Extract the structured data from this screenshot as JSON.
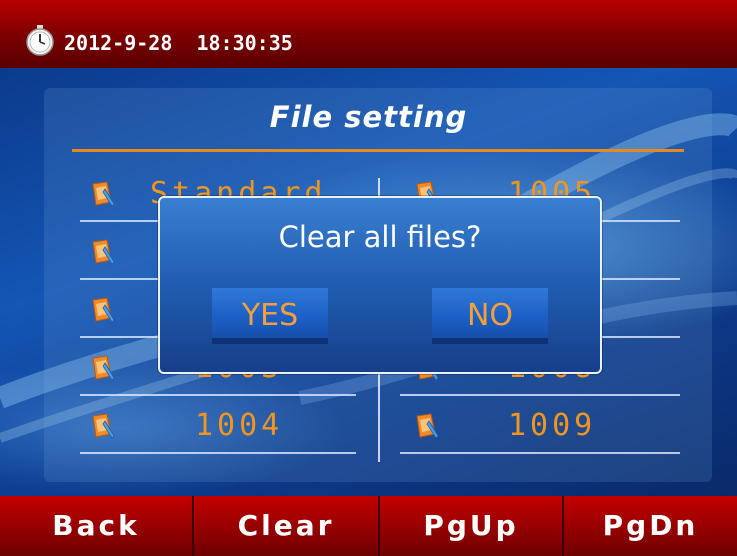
{
  "status_bar": {
    "datetime": "2012-9-28  18:30:35",
    "clock_icon": "stopwatch-icon"
  },
  "screen": {
    "title": "File setting"
  },
  "files": {
    "left": [
      {
        "label": "Standard",
        "icon": "file-edit-icon"
      },
      {
        "label": "",
        "icon": "file-edit-icon"
      },
      {
        "label": "",
        "icon": "file-edit-icon"
      },
      {
        "label": "1003",
        "icon": "file-edit-icon"
      },
      {
        "label": "1004",
        "icon": "file-edit-icon"
      }
    ],
    "right": [
      {
        "label": "1005",
        "icon": "file-edit-icon"
      },
      {
        "label": "",
        "icon": "file-edit-icon"
      },
      {
        "label": "",
        "icon": "file-edit-icon"
      },
      {
        "label": "1008",
        "icon": "file-edit-icon"
      },
      {
        "label": "1009",
        "icon": "file-edit-icon"
      }
    ]
  },
  "dialog": {
    "message": "Clear all files?",
    "yes_label": "YES",
    "no_label": "NO"
  },
  "bottom_bar": {
    "back_label": "Back",
    "clear_label": "Clear",
    "pgup_label": "PgUp",
    "pgdn_label": "PgDn"
  },
  "colors": {
    "accent_orange": "#f0951f",
    "bar_red": "#b80000",
    "panel_blue": "#1456b4"
  }
}
